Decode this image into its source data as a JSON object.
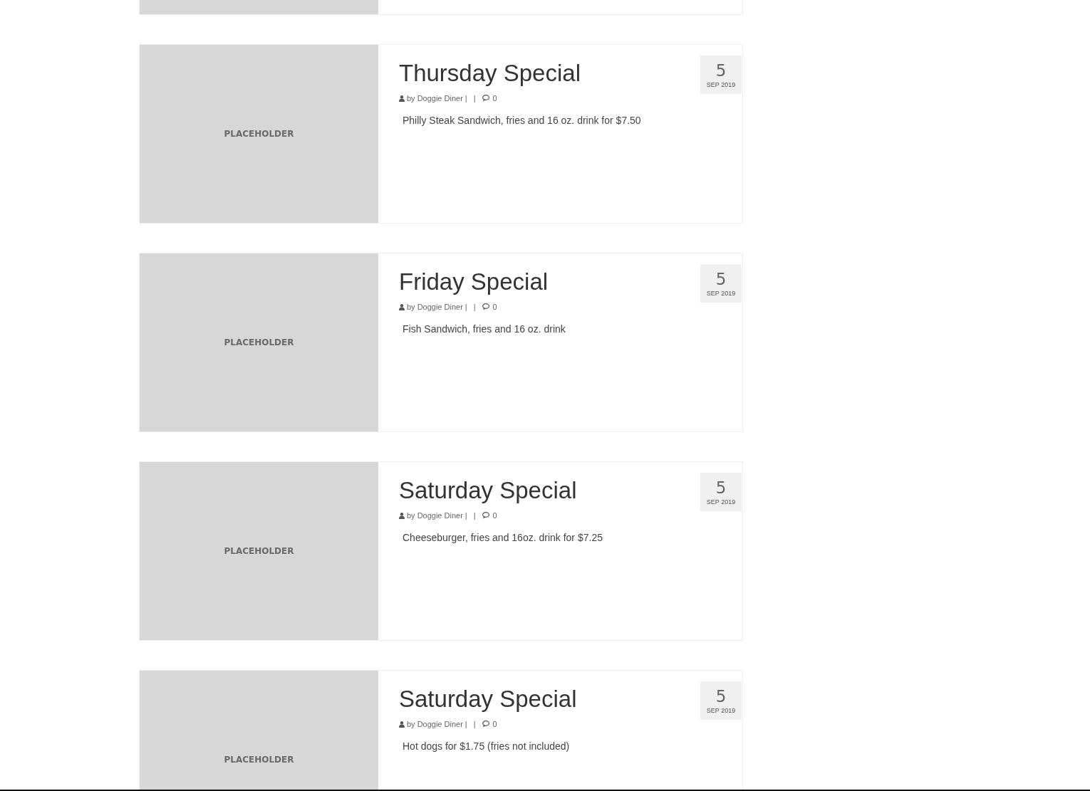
{
  "posts": [
    {
      "title": "Thursday Special",
      "image_label": "PLACEHOLDER",
      "author_prefix": "by",
      "author": "Doggie Diner",
      "separator": "|",
      "comments": "0",
      "excerpt": "Philly Steak Sandwich, fries and 16 oz. drink for $7.50",
      "day": "5",
      "month_year": "SEP 2019"
    },
    {
      "title": "Friday Special",
      "image_label": "PLACEHOLDER",
      "author_prefix": "by",
      "author": "Doggie Diner",
      "separator": "|",
      "comments": "0",
      "excerpt": "Fish Sandwich, fries and 16 oz. drink",
      "day": "5",
      "month_year": "SEP 2019"
    },
    {
      "title": "Saturday Special",
      "image_label": "PLACEHOLDER",
      "author_prefix": "by",
      "author": "Doggie Diner",
      "separator": "|",
      "comments": "0",
      "excerpt": "Cheeseburger, fries and 16oz. drink for $7.25",
      "day": "5",
      "month_year": "SEP 2019"
    },
    {
      "title": "Saturday Special",
      "image_label": "PLACEHOLDER",
      "author_prefix": "by",
      "author": "Doggie Diner",
      "separator": "|",
      "comments": "0",
      "excerpt": "Hot dogs for $1.75 (fries not included)",
      "day": "5",
      "month_year": "SEP 2019"
    }
  ]
}
